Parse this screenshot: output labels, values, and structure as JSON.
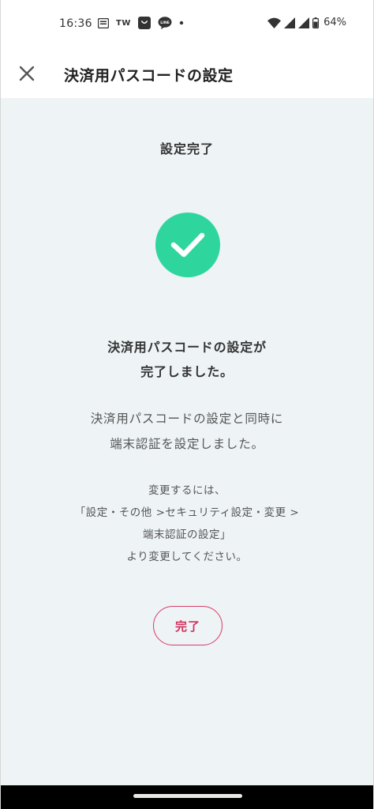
{
  "status_bar": {
    "time": "16:36",
    "notif_tw": "TW",
    "notif_line": "LINE",
    "battery": "64%",
    "icons": [
      "message-icon",
      "tw-icon",
      "shopping-bag-icon",
      "line-icon",
      "dot-icon",
      "wifi-icon",
      "signal-icon",
      "signal-icon-2",
      "battery-icon"
    ]
  },
  "header": {
    "title": "決済用パスコードの設定",
    "close_icon": "close-icon"
  },
  "main": {
    "section_title": "設定完了",
    "check_color": "#2ed69e",
    "heading_lines": [
      "決済用パスコードの設定が",
      "完了しました。"
    ],
    "description_lines": [
      "決済用パスコードの設定と同時に",
      "端末認証を設定しました。"
    ],
    "note_lines": [
      "変更するには、",
      "「設定・その他 >セキュリティ設定・変更 >",
      "端末認証の設定」",
      "より変更してください。"
    ],
    "complete_label": "完了",
    "accent_color": "#d83b64"
  }
}
